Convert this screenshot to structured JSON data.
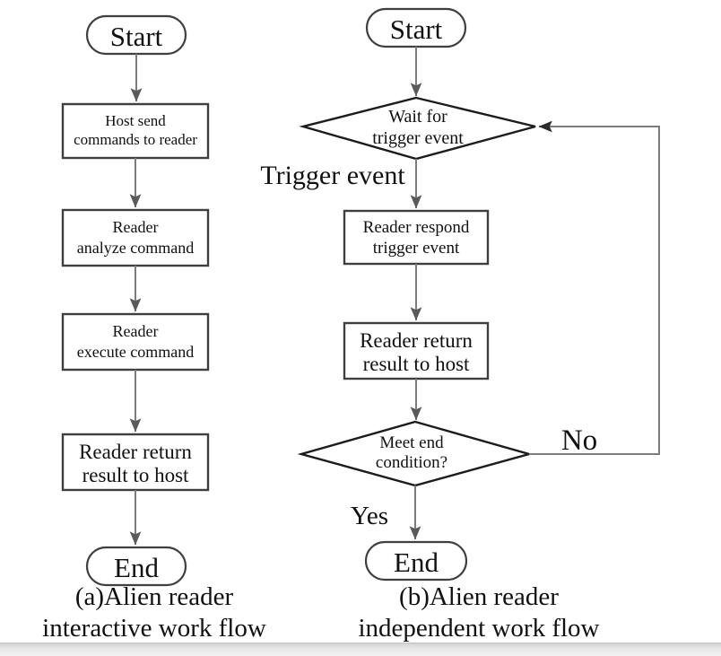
{
  "figure": {
    "background_color": "#ffffff",
    "shape_outline_color": "#3f3f3f",
    "diamond_outline_color": "#1c1c1c",
    "connector_color": "#7d7d7d",
    "text_color": "#111111"
  },
  "diagram_a": {
    "caption": "(a)Alien reader\ninteractive work flow",
    "nodes": {
      "start": "Start",
      "host_send": "Host send\ncommands to reader",
      "host_send_line1": "Host send",
      "host_send_line2": "commands to reader",
      "analyze": "Reader\nanalyze command",
      "analyze_line1": "Reader",
      "analyze_line2": "analyze command",
      "execute": "Reader\nexecute command",
      "execute_line1": "Reader",
      "execute_line2": "execute command",
      "return_result": "Reader return\nresult to host",
      "return_result_line1": "Reader return",
      "return_result_line2": "result to host",
      "end": "End"
    }
  },
  "diagram_b": {
    "caption": "(b)Alien reader\nindependent work flow",
    "nodes": {
      "start": "Start",
      "wait": "Wait for\ntrigger event",
      "wait_line1": "Wait for",
      "wait_line2": "trigger event",
      "respond": "Reader respond\ntrigger event",
      "respond_line1": "Reader respond",
      "respond_line2": "trigger event",
      "return_result": "Reader return\nresult to host",
      "return_result_line1": "Reader return",
      "return_result_line2": "result to host",
      "decision": "Meet end\ncondition?",
      "decision_line1": "Meet end",
      "decision_line2": "condition?",
      "end": "End"
    },
    "edge_labels": {
      "trigger_event": "Trigger event",
      "yes": "Yes",
      "no": "No"
    }
  }
}
